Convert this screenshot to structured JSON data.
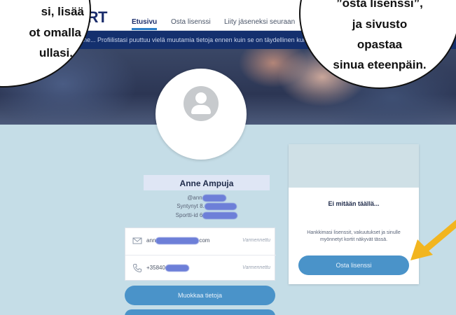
{
  "nav": {
    "logo": "ORT",
    "links": [
      "Etusivu",
      "Osta lisenssi",
      "Liity jäseneksi seuraan"
    ]
  },
  "notice": "Anne... Profiilistasi puuttuu vielä muutamia tietoja ennen kuin se on täydellinen kuin",
  "profile": {
    "name": "Anne Ampuja",
    "handle": "@ann",
    "born": "Syntynyt 8.",
    "sport_id": "Sportti-id 6"
  },
  "contact": {
    "email": "ann",
    "email_suffix": "com",
    "phone": "+35840",
    "verified_label": "Varmennettu"
  },
  "buttons": {
    "edit": "Muokkaa tietoja"
  },
  "license_card": {
    "title": "Ei mitään täällä...",
    "text": "Hankkimasi lisenssit, vakuutukset ja sinulle myönnetyt kortit näkyvät tässä.",
    "button": "Osta lisenssi"
  },
  "bubble_left": [
    "si, lisää",
    "ot omalla",
    "ullasi."
  ],
  "bubble_right": [
    "”osta lisenssi”,",
    "ja sivusto",
    "opastaa",
    "sinua eteenpäin."
  ],
  "colors": {
    "brand_navy": "#14306e",
    "button_blue": "#4a93c9",
    "band_blue": "#c5dde7",
    "arrow_yellow": "#f2b51f"
  }
}
